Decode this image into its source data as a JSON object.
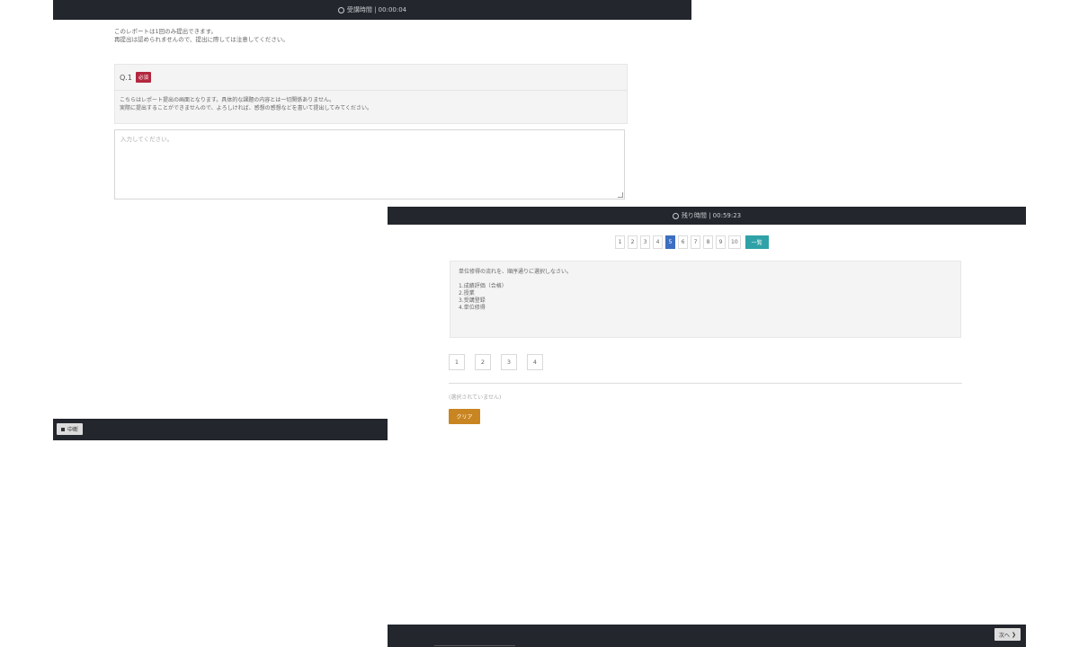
{
  "panel_a": {
    "timer_label": "受講時間",
    "timer_value": "00:00:04",
    "notice": [
      "このレポートは1回のみ提出できます。",
      "再提出は認められませんので、提出に際しては注意してください。"
    ],
    "question": {
      "number": "Q.1",
      "required_badge": "必須",
      "text": [
        "こちらはレポート提出の画面となります。具体的な課題の内容とは一切関係ありません。",
        "実際に提出することができませんので、よろしければ、感想の感想などを書いて提出してみてください。"
      ]
    },
    "answer_placeholder": "入力してください。",
    "interrupt_button": "中断"
  },
  "panel_b": {
    "timer_label": "残り時間",
    "timer_value": "00:59:23",
    "pages": [
      "1",
      "2",
      "3",
      "4",
      "5",
      "6",
      "7",
      "8",
      "9",
      "10"
    ],
    "active_page": "5",
    "list_button": "一覧",
    "question_prompt": "単位修得の流れを、順序通りに選択しなさい。",
    "question_items": [
      "1.成績評価（合格）",
      "2.授業",
      "3.受講登録",
      "4.単位修得"
    ],
    "choices": [
      "1",
      "2",
      "3",
      "4"
    ],
    "selection_status": "(選択されていません)",
    "clear_button": "クリア",
    "next_button": "次へ"
  }
}
